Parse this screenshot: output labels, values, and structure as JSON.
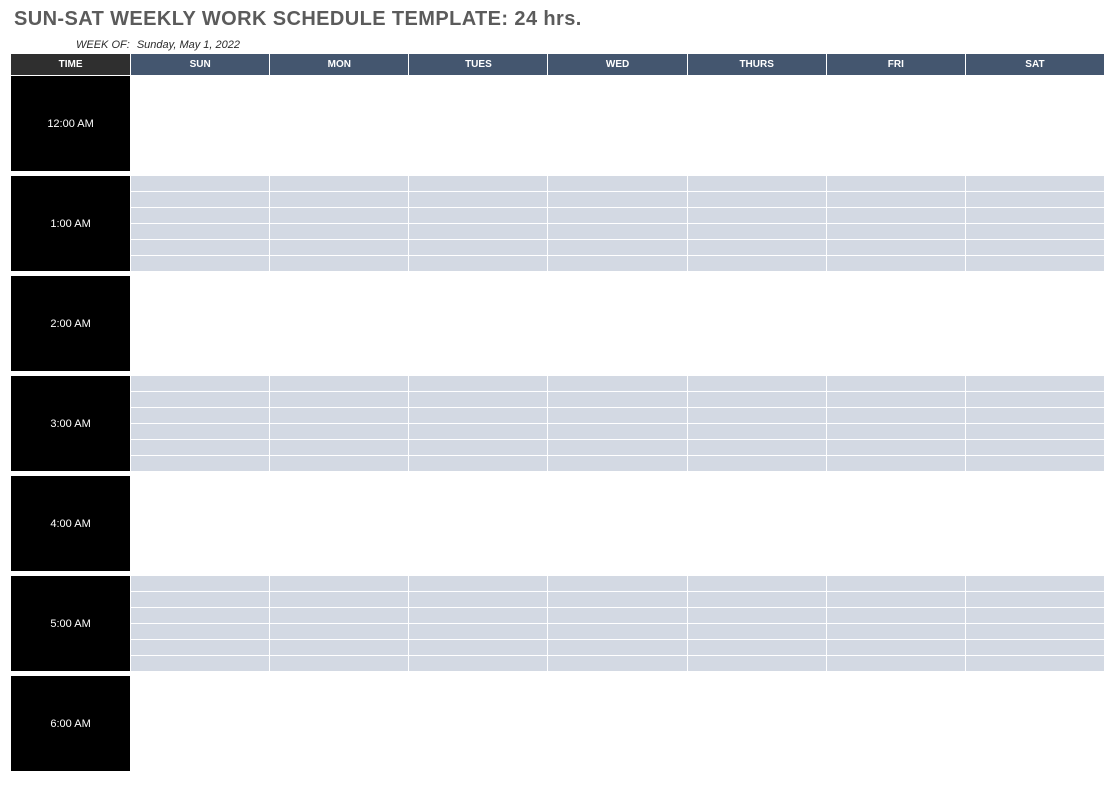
{
  "title": "SUN-SAT WEEKLY WORK SCHEDULE TEMPLATE: 24 hrs.",
  "week_of_label": "WEEK OF:",
  "week_of_value": "Sunday, May 1, 2022",
  "header": {
    "time": "TIME",
    "days": [
      "SUN",
      "MON",
      "TUES",
      "WED",
      "THURS",
      "FRI",
      "SAT"
    ]
  },
  "colors": {
    "title_text": "#5b5b5b",
    "time_header_bg": "#2f2f2f",
    "day_header_bg": "#44566f",
    "time_cell_bg": "#000000",
    "shaded_row_bg": "#d3d9e3"
  },
  "subrows_per_hour": 6,
  "hours": [
    {
      "label": "12:00 AM",
      "shaded": false
    },
    {
      "label": "1:00 AM",
      "shaded": true
    },
    {
      "label": "2:00 AM",
      "shaded": false
    },
    {
      "label": "3:00 AM",
      "shaded": true
    },
    {
      "label": "4:00 AM",
      "shaded": false
    },
    {
      "label": "5:00 AM",
      "shaded": true
    },
    {
      "label": "6:00 AM",
      "shaded": false
    }
  ]
}
